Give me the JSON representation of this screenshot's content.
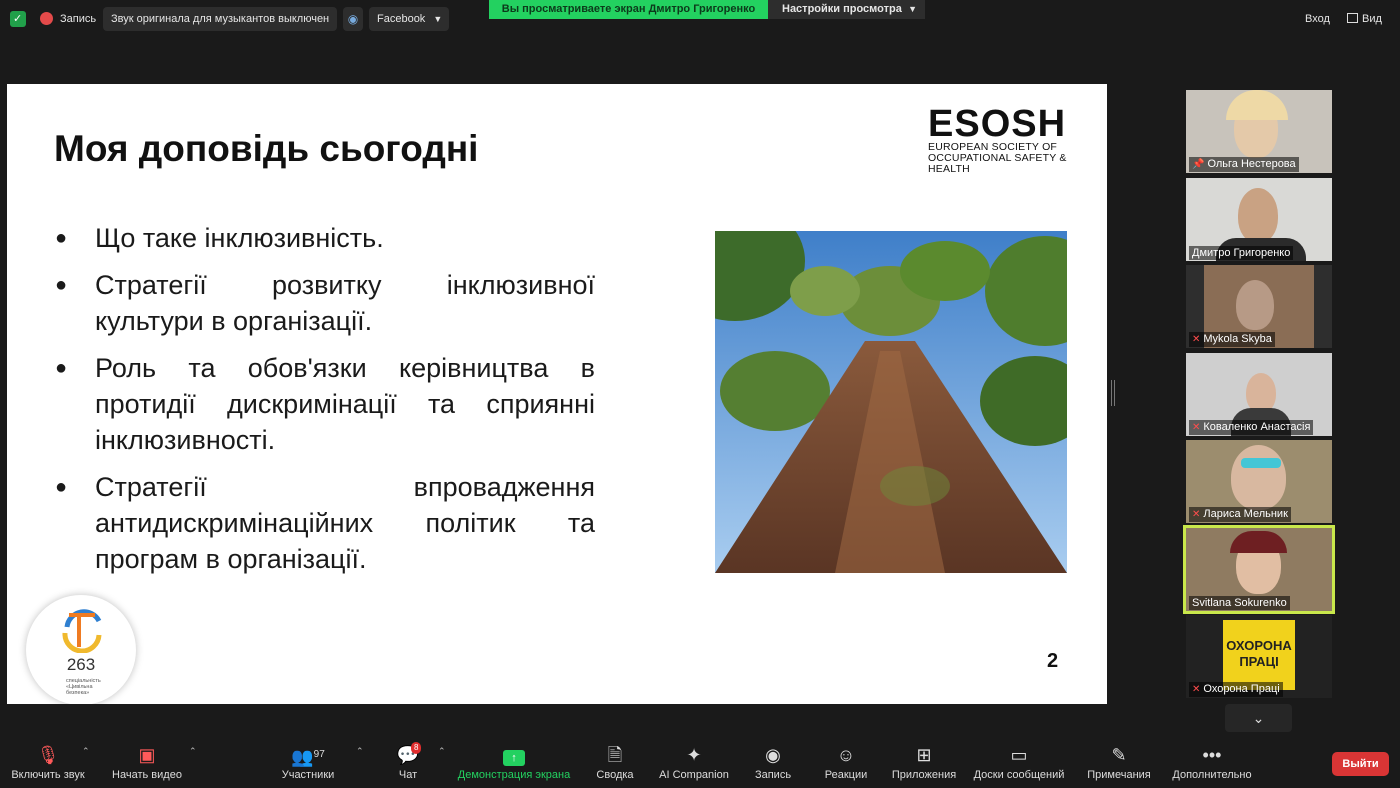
{
  "topbar": {
    "recording_label": "Запись",
    "original_audio": "Звук оригинала для музыкантов выключен",
    "stream_target": "Facebook",
    "viewing_banner": "Вы просматриваете экран Дмитро Григоренко",
    "view_options": "Настройки просмотра",
    "enter": "Вход",
    "view": "Вид"
  },
  "slide": {
    "title": "Моя доповідь сьогодні",
    "logo_main": "ESOSH",
    "logo_sub_1": "EUROPEAN SOCIETY OF",
    "logo_sub_2": "OCCUPATIONAL SAFETY & HEALTH",
    "bullets": [
      "Що таке інклюзивність.",
      "Стратегії розвитку інклюзивної культури в організації.",
      "Роль та обов'язки керівництва в протидії дискримінації та сприянні інклюзивності.",
      "Стратегії впровадження антидискримінаційних політик та програм в організації."
    ],
    "page_number": "2",
    "badge_number": "263",
    "badge_caption_1": "спеціальність",
    "badge_caption_2": "«Цивільна",
    "badge_caption_3": "безпека»"
  },
  "participants": [
    {
      "name": "Ольга Нестерова",
      "icon": "pin-icon"
    },
    {
      "name": "Дмитро Григоренко",
      "icon": ""
    },
    {
      "name": "Mykola Skyba",
      "icon": "mic-off-icon"
    },
    {
      "name": "Коваленко Анастасія",
      "icon": "mic-off-icon"
    },
    {
      "name": "Лариса Мельник",
      "icon": "mic-off-icon"
    },
    {
      "name": "Svitlana Sokurenko",
      "icon": "",
      "active_speaker": true
    },
    {
      "name": "Охорона Праці",
      "icon": "mic-off-icon",
      "poster_text_1": "ОХОРОНА",
      "poster_text_2": "ПРАЦІ"
    }
  ],
  "toolbar": {
    "unmute": "Включить звук",
    "start_video": "Начать видео",
    "participants": "Участники",
    "participants_count": "97",
    "chat": "Чат",
    "chat_badge": "8",
    "share_screen": "Демонстрация экрана",
    "summary": "Сводка",
    "ai_companion": "AI Companion",
    "record": "Запись",
    "reactions": "Реакции",
    "apps": "Приложения",
    "whiteboards": "Доски сообщений",
    "notes": "Примечания",
    "more": "Дополнительно",
    "leave": "Выйти"
  },
  "colors": {
    "share_green": "#23d160",
    "leave_red": "#d93535",
    "active_speaker_border": "#c9e84b"
  }
}
